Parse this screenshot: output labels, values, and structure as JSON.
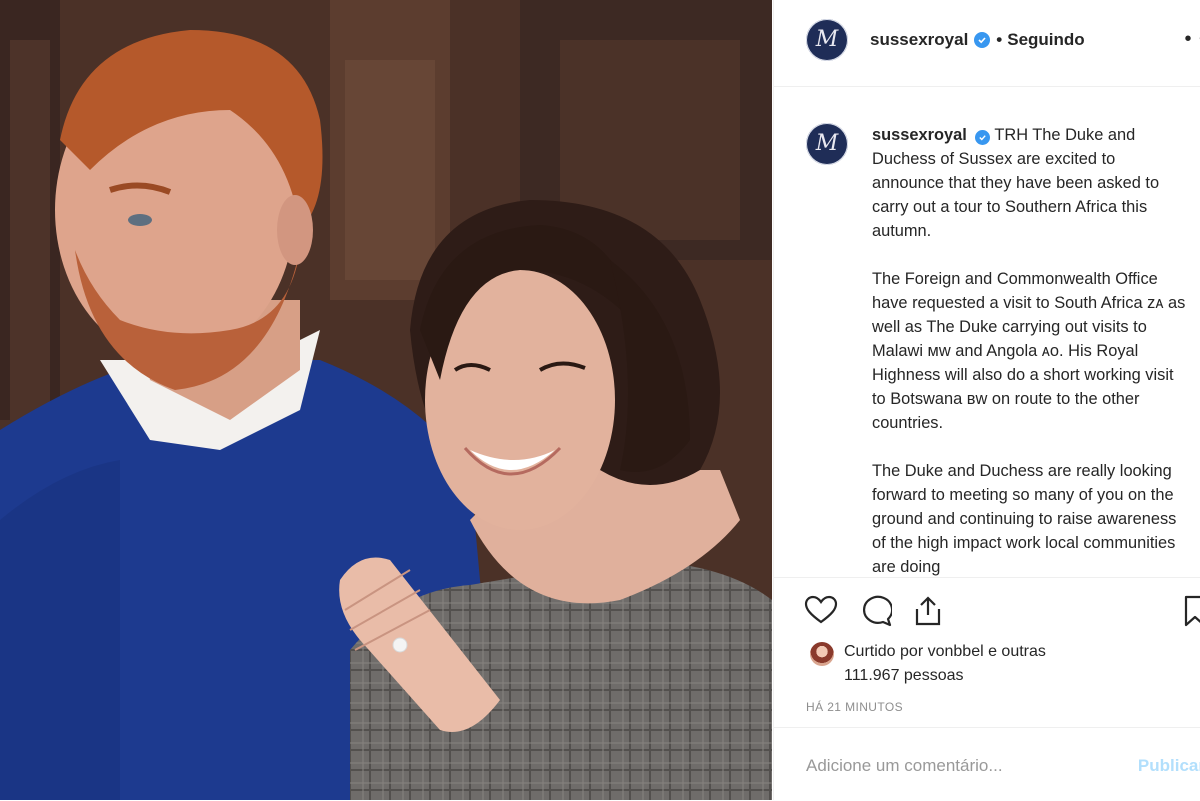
{
  "post": {
    "username": "sussexroyal",
    "separator": "•",
    "follow_status": "Seguindo",
    "more_icon": "more-dots",
    "avatar_letter": "M",
    "caption_paragraphs": [
      "TRH The Duke and Duchess of Sussex are excited to announce that they have been asked to carry out a tour to Southern Africa this autumn.",
      "The Foreign and Commonwealth Office have requested a visit to South Africa ᴢᴀ as well as The Duke carrying out visits to Malawi ᴍᴡ and Angola ᴀᴏ. His Royal Highness will also do a short working visit to Botswana ʙᴡ on route to the other countries.",
      "The Duke and Duchess are really looking forward to meeting so many of you on the ground and continuing to raise awareness of the high impact work local communities are doing"
    ],
    "liked_by": "Curtido por vonbbel e outras 111.967 pessoas",
    "timestamp": "HÁ 21 MINUTOS",
    "comment_placeholder": "Adicione um comentário...",
    "publish_label": "Publicar",
    "icons": [
      "heart-icon",
      "comment-icon",
      "share-icon",
      "bookmark-icon"
    ],
    "colors": {
      "verified": "#3897f0",
      "avatar_bg": "#1f2d57",
      "publish": "#b2dffc",
      "muted": "#8e8e8e"
    }
  }
}
